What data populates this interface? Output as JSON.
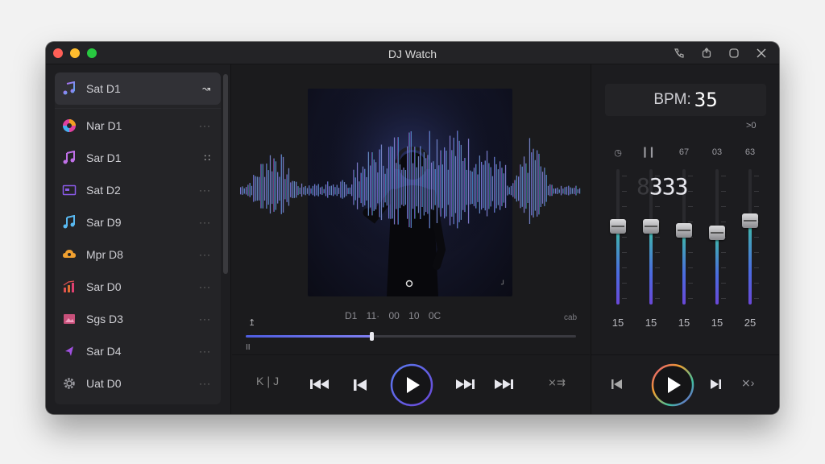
{
  "window": {
    "title": "DJ Watch",
    "lights": [
      "#ff5f57",
      "#febc2e",
      "#28c840"
    ]
  },
  "playlist": {
    "items": [
      {
        "label": "Sat D1",
        "icon": "music-note-icon",
        "more": "↝",
        "active": true
      },
      {
        "label": "Nar D1",
        "icon": "vinyl-icon",
        "more": "···"
      },
      {
        "label": "Sar D1",
        "icon": "music-note-icon",
        "more": "∷"
      },
      {
        "label": "Sat D2",
        "icon": "screen-icon",
        "more": "···"
      },
      {
        "label": "Sar D9",
        "icon": "music-note-icon",
        "more": "···"
      },
      {
        "label": "Mpr D8",
        "icon": "cloud-icon",
        "more": "···"
      },
      {
        "label": "Sar D0",
        "icon": "bar-chart-icon",
        "more": "···"
      },
      {
        "label": "Sgs D3",
        "icon": "image-icon",
        "more": "···"
      },
      {
        "label": "Sar D4",
        "icon": "cursor-icon",
        "more": "···"
      },
      {
        "label": "Uat D0",
        "icon": "gear-icon",
        "more": "···"
      }
    ]
  },
  "player": {
    "timecode": "D1 11· 00 10 0C",
    "end_label": "cab",
    "pin_glyph": "↥",
    "pause_glyph": "II",
    "progress": 0.38,
    "controls": {
      "left_glyph": "K❘J",
      "right_glyph": "⨯⇉"
    }
  },
  "mixer": {
    "bpm_label": "BPM:",
    "bpm_value": "35",
    "sub_label": ">0",
    "segment_display": "333",
    "segment_ghost": "8",
    "channels": [
      {
        "head": "◷",
        "value": "15",
        "level": 0.58
      },
      {
        "head": "▎▎",
        "value": "15",
        "level": 0.58
      },
      {
        "head": "67",
        "value": "15",
        "level": 0.55
      },
      {
        "head": "03",
        "value": "15",
        "level": 0.53
      },
      {
        "head": "63",
        "value": "25",
        "level": 0.62
      }
    ],
    "controls": {
      "right_glyph": "⨯›"
    }
  }
}
